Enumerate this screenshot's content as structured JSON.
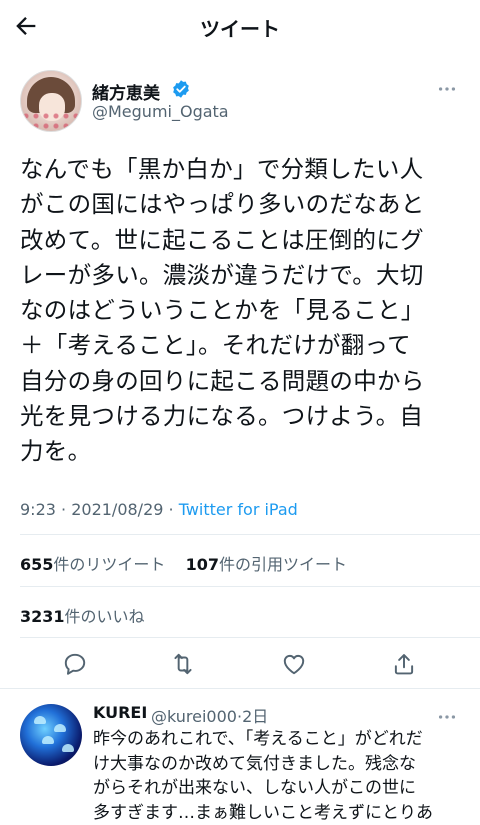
{
  "header": {
    "title": "ツイート"
  },
  "author": {
    "name": "緒方恵美",
    "handle": "@Megumi_Ogata"
  },
  "tweet": {
    "text": "なんでも「黒か白か」で分類したい人\nがこの国にはやっぱり多いのだなあと\n改めて。世に起こることは圧倒的にグ\nレーが多い。濃淡が違うだけで。大切\nなのはどういうことかを「見ること」\n＋「考えること」。それだけが翻って\n自分の身の回りに起こる問題の中から\n光を見つける力になる。つけよう。自\n力を。",
    "time": "9:23",
    "date": "2021/08/29",
    "source": "Twitter for iPad"
  },
  "stats": {
    "retweet_count": "655",
    "retweet_label": "件のリツイート",
    "quote_count": "107",
    "quote_label": "件の引用ツイート",
    "like_count": "3231",
    "like_label": "件のいいね"
  },
  "actions": [
    "reply-icon",
    "retweet-icon",
    "like-icon",
    "share-icon"
  ],
  "reply": {
    "name": "KUREI",
    "handle": "@kurei000",
    "time": "2日",
    "text": "昨今のあれこれで、「考えること」がどれだ\nけ大事なのか改めて気付きました。残念な\nがらそれが出来ない、しない人がこの世に\n多すぎます…まぁ難しいこと考えずにとりあ"
  },
  "colors": {
    "accent": "#1d9bf0",
    "secondary_text": "#536471",
    "divider": "#e6ecf0"
  }
}
